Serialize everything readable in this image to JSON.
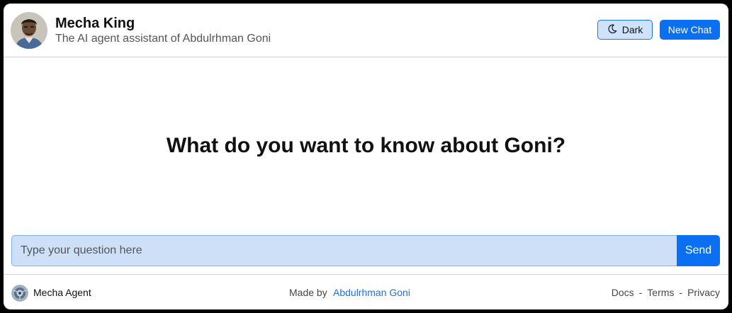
{
  "header": {
    "title": "Mecha King",
    "subtitle": "The AI agent assistant of Abdulrhman Goni",
    "avatar_icon": "person-avatar-icon",
    "dark_toggle_label": "Dark",
    "dark_toggle_icon": "moon-icon",
    "new_chat_label": "New Chat"
  },
  "main": {
    "headline": "What do you want to know about Goni?",
    "input_placeholder": "Type your question here",
    "input_value": "",
    "send_label": "Send"
  },
  "footer": {
    "brand_icon": "mecha-agent-logo-icon",
    "brand_label": "Mecha Agent",
    "made_by_text": "Made by",
    "author_link": "Abdulrhman Goni",
    "links": [
      "Docs",
      "Terms",
      "Privacy"
    ],
    "separator": "-"
  },
  "colors": {
    "accent": "#0a6ff0",
    "input_bg": "#cde0f8",
    "dark_button_bg": "#cfe2fb",
    "link": "#1a73e8"
  }
}
